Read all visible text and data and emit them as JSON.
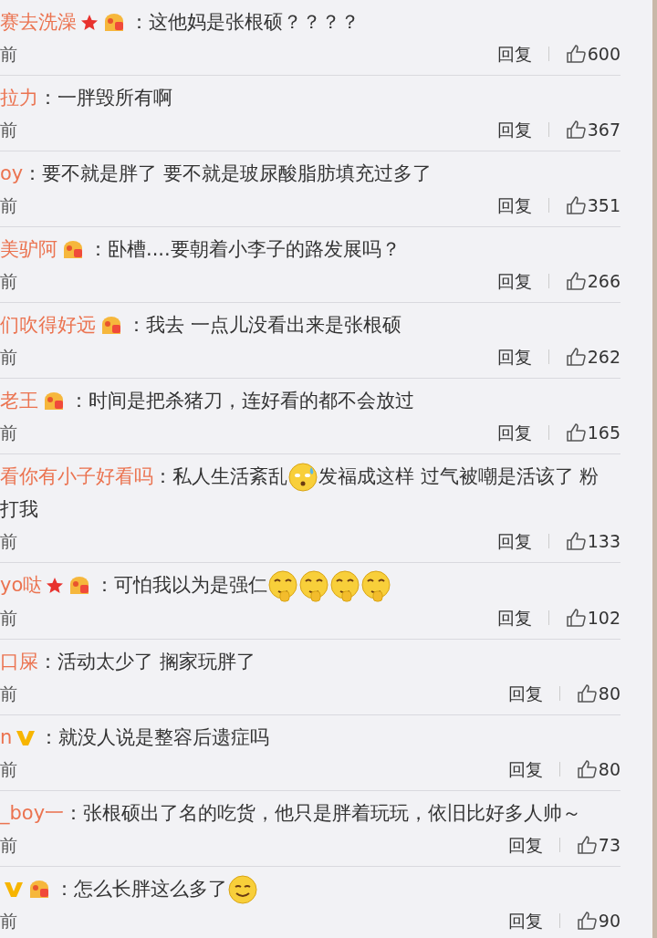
{
  "comments": [
    {
      "user": "赛去洗澡",
      "star": true,
      "medal": true,
      "parts": [
        {
          "kind": "text",
          "text": "：这他妈是张根硕？？？？"
        }
      ],
      "time": "前",
      "reply": "回复",
      "likes": "600"
    },
    {
      "user": "拉力",
      "parts": [
        {
          "kind": "text",
          "text": "：一胖毁所有啊"
        }
      ],
      "time": "前",
      "reply": "回复",
      "likes": "367"
    },
    {
      "user": "oy",
      "parts": [
        {
          "kind": "text",
          "text": "：要不就是胖了  要不就是玻尿酸脂肪填充过多了"
        }
      ],
      "time": "前",
      "reply": "回复",
      "likes": "351"
    },
    {
      "user": "美驴阿",
      "medal": true,
      "parts": [
        {
          "kind": "text",
          "text": "：卧槽....要朝着小李子的路发展吗？"
        }
      ],
      "time": "前",
      "reply": "回复",
      "likes": "266"
    },
    {
      "user": "们吹得好远",
      "medal": true,
      "parts": [
        {
          "kind": "text",
          "text": "：我去 一点儿没看出来是张根硕"
        }
      ],
      "time": "前",
      "reply": "回复",
      "likes": "262"
    },
    {
      "user": "老王",
      "medal": true,
      "parts": [
        {
          "kind": "text",
          "text": "：时间是把杀猪刀，连好看的都不会放过"
        }
      ],
      "time": "前",
      "reply": "回复",
      "likes": "165"
    },
    {
      "user": "看你有小子好看吗",
      "parts": [
        {
          "kind": "text",
          "text": "：私人生活紊乱"
        },
        {
          "kind": "sweat"
        },
        {
          "kind": "text",
          "text": "发福成这样 过气被嘲是活该了 粉"
        },
        {
          "kind": "text",
          "text": "打我"
        }
      ],
      "time": "前",
      "reply": "回复",
      "likes": "133"
    },
    {
      "user": "yo哒",
      "star": true,
      "medal": true,
      "parts": [
        {
          "kind": "text",
          "text": "：可怕我以为是强仁"
        },
        {
          "kind": "think"
        },
        {
          "kind": "think"
        },
        {
          "kind": "think"
        },
        {
          "kind": "think"
        }
      ],
      "time": "前",
      "reply": "回复",
      "likes": "102"
    },
    {
      "user": "口屎",
      "parts": [
        {
          "kind": "text",
          "text": "：活动太少了 搁家玩胖了"
        }
      ],
      "time": "前",
      "reply": "回复",
      "likes": "80"
    },
    {
      "user": "n",
      "verified": true,
      "parts": [
        {
          "kind": "text",
          "text": "：就没人说是整容后遗症吗"
        }
      ],
      "time": "前",
      "reply": "回复",
      "likes": "80"
    },
    {
      "user": "_boy一",
      "parts": [
        {
          "kind": "text",
          "text": "：张根硕出了名的吃货，他只是胖着玩玩，依旧比好多人帅～"
        }
      ],
      "time": "前",
      "reply": "回复",
      "likes": "73"
    },
    {
      "verified": true,
      "medal": true,
      "parts": [
        {
          "kind": "text",
          "text": "：怎么长胖这么多了"
        },
        {
          "kind": "smile"
        }
      ],
      "time": "前",
      "reply": "回复",
      "likes": "90"
    }
  ]
}
